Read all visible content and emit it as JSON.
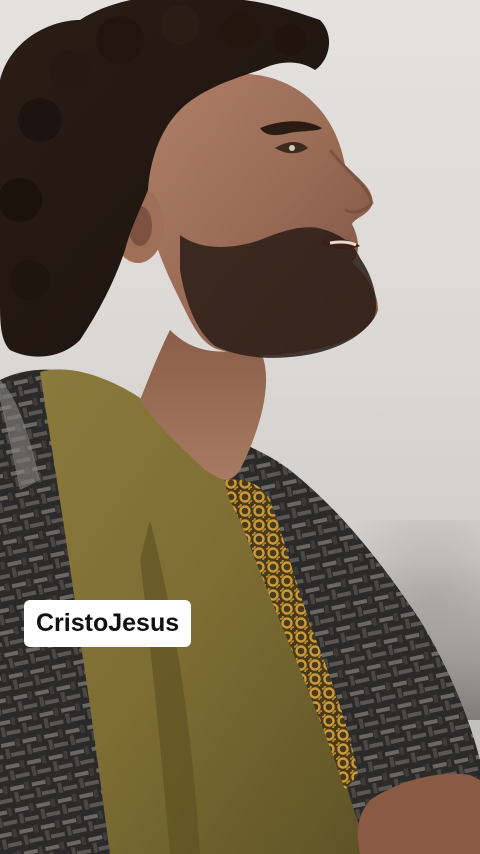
{
  "video": {
    "caption_text": "CristoJesus"
  }
}
